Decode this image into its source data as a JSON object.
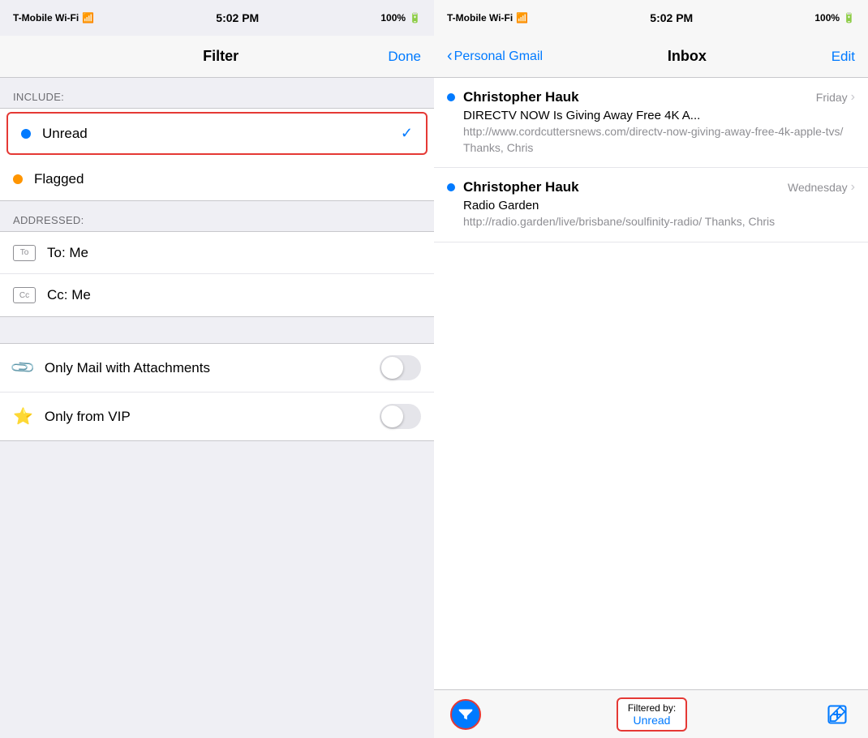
{
  "left": {
    "status_bar": {
      "carrier": "T-Mobile Wi-Fi",
      "time": "5:02 PM",
      "battery": "100%"
    },
    "nav": {
      "title": "Filter",
      "done_label": "Done"
    },
    "include_section": {
      "label": "INCLUDE:"
    },
    "filter_items": [
      {
        "id": "unread",
        "label": "Unread",
        "dot": "blue",
        "selected": true,
        "checked": true
      },
      {
        "id": "flagged",
        "label": "Flagged",
        "dot": "orange",
        "selected": false,
        "checked": false
      }
    ],
    "addressed_section": {
      "label": "ADDRESSED:"
    },
    "addressed_items": [
      {
        "id": "to-me",
        "icon": "To",
        "label": "To: Me"
      },
      {
        "id": "cc-me",
        "icon": "Cc",
        "label": "Cc: Me"
      }
    ],
    "toggle_items": [
      {
        "id": "attachments",
        "icon": "clip",
        "label": "Only Mail with Attachments",
        "enabled": false
      },
      {
        "id": "vip",
        "icon": "star",
        "label": "Only from VIP",
        "enabled": false
      }
    ]
  },
  "right": {
    "status_bar": {
      "carrier": "T-Mobile Wi-Fi",
      "time": "5:02 PM",
      "battery": "100%"
    },
    "nav": {
      "back_label": "Personal Gmail",
      "title": "Inbox",
      "edit_label": "Edit"
    },
    "emails": [
      {
        "sender": "Christopher Hauk",
        "date": "Friday",
        "subject": "DIRECTV NOW Is Giving Away Free 4K A...",
        "preview": "http://www.cordcuttersnews.com/directv-now-giving-away-free-4k-apple-tvs/ Thanks, Chris",
        "unread": true
      },
      {
        "sender": "Christopher Hauk",
        "date": "Wednesday",
        "subject": "Radio Garden",
        "preview": "http://radio.garden/live/brisbane/soulfinity-radio/ Thanks, Chris",
        "unread": true
      }
    ],
    "toolbar": {
      "filter_icon": "filter",
      "filtered_by_label": "Filtered by:",
      "filtered_by_value": "Unread",
      "compose_icon": "compose"
    }
  }
}
